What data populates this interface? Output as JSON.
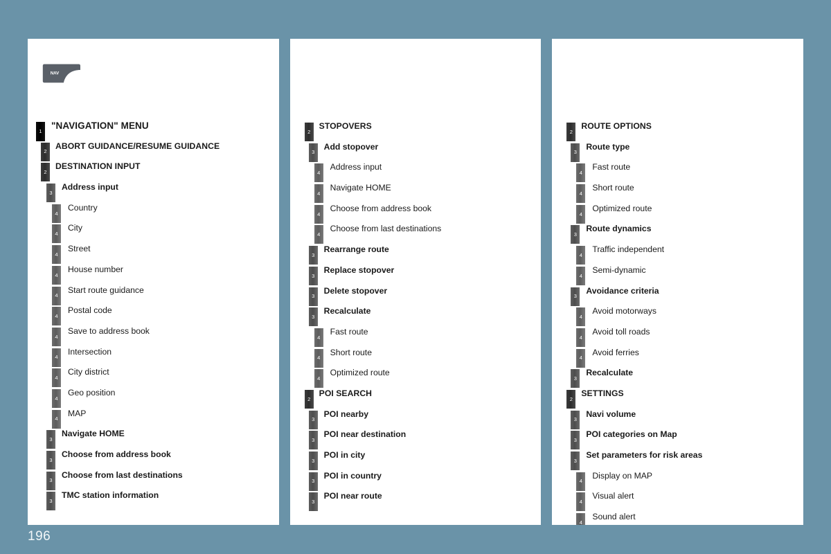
{
  "page": {
    "number": "196",
    "background_color": "#6a93a8",
    "card_color": "#ffffff"
  },
  "nav_icon": {
    "name": "nav-icon",
    "label": "NAV",
    "color": "#5a6068"
  },
  "columns": [
    {
      "id": "column-1",
      "has_nav_icon": true,
      "rows": [
        {
          "level": 1,
          "label": "\"NAVIGATION\" MENU"
        },
        {
          "level": 2,
          "label": "ABORT GUIDANCE/RESUME GUIDANCE"
        },
        {
          "level": 2,
          "label": "DESTINATION INPUT"
        },
        {
          "level": 3,
          "label": "Address input"
        },
        {
          "level": 4,
          "label": "Country"
        },
        {
          "level": 4,
          "label": "City"
        },
        {
          "level": 4,
          "label": "Street"
        },
        {
          "level": 4,
          "label": "House number"
        },
        {
          "level": 4,
          "label": "Start route guidance"
        },
        {
          "level": 4,
          "label": "Postal code"
        },
        {
          "level": 4,
          "label": "Save to address book"
        },
        {
          "level": 4,
          "label": "Intersection"
        },
        {
          "level": 4,
          "label": "City district"
        },
        {
          "level": 4,
          "label": "Geo position"
        },
        {
          "level": 4,
          "label": "MAP"
        },
        {
          "level": 3,
          "label": "Navigate HOME"
        },
        {
          "level": 3,
          "label": "Choose from address book"
        },
        {
          "level": 3,
          "label": "Choose from last destinations"
        },
        {
          "level": 3,
          "label": "TMC station information"
        }
      ]
    },
    {
      "id": "column-2",
      "has_nav_icon": false,
      "rows": [
        {
          "level": 2,
          "label": "STOPOVERS"
        },
        {
          "level": 3,
          "label": "Add stopover"
        },
        {
          "level": 4,
          "label": "Address input"
        },
        {
          "level": 4,
          "label": "Navigate HOME"
        },
        {
          "level": 4,
          "label": "Choose from address book"
        },
        {
          "level": 4,
          "label": "Choose from last destinations"
        },
        {
          "level": 3,
          "label": "Rearrange route"
        },
        {
          "level": 3,
          "label": "Replace stopover"
        },
        {
          "level": 3,
          "label": "Delete stopover"
        },
        {
          "level": 3,
          "label": "Recalculate"
        },
        {
          "level": 4,
          "label": "Fast route"
        },
        {
          "level": 4,
          "label": "Short route"
        },
        {
          "level": 4,
          "label": "Optimized route"
        },
        {
          "level": 2,
          "label": "POI SEARCH"
        },
        {
          "level": 3,
          "label": "POI nearby"
        },
        {
          "level": 3,
          "label": "POI near destination"
        },
        {
          "level": 3,
          "label": "POI in city"
        },
        {
          "level": 3,
          "label": "POI in country"
        },
        {
          "level": 3,
          "label": "POI near route"
        }
      ]
    },
    {
      "id": "column-3",
      "has_nav_icon": false,
      "rows": [
        {
          "level": 2,
          "label": "ROUTE OPTIONS"
        },
        {
          "level": 3,
          "label": "Route type"
        },
        {
          "level": 4,
          "label": "Fast route"
        },
        {
          "level": 4,
          "label": "Short route"
        },
        {
          "level": 4,
          "label": "Optimized route"
        },
        {
          "level": 3,
          "label": "Route dynamics"
        },
        {
          "level": 4,
          "label": "Traffic independent"
        },
        {
          "level": 4,
          "label": "Semi-dynamic"
        },
        {
          "level": 3,
          "label": "Avoidance criteria"
        },
        {
          "level": 4,
          "label": "Avoid motorways"
        },
        {
          "level": 4,
          "label": "Avoid toll roads"
        },
        {
          "level": 4,
          "label": "Avoid ferries"
        },
        {
          "level": 3,
          "label": "Recalculate"
        },
        {
          "level": 2,
          "label": "SETTINGS"
        },
        {
          "level": 3,
          "label": "Navi volume"
        },
        {
          "level": 3,
          "label": "POI categories on Map"
        },
        {
          "level": 3,
          "label": "Set parameters for risk areas"
        },
        {
          "level": 4,
          "label": "Display on MAP"
        },
        {
          "level": 4,
          "label": "Visual alert"
        },
        {
          "level": 4,
          "label": "Sound alert"
        }
      ]
    }
  ],
  "level_badges": {
    "1": "1",
    "2": "2",
    "3": "3",
    "4": "4"
  }
}
